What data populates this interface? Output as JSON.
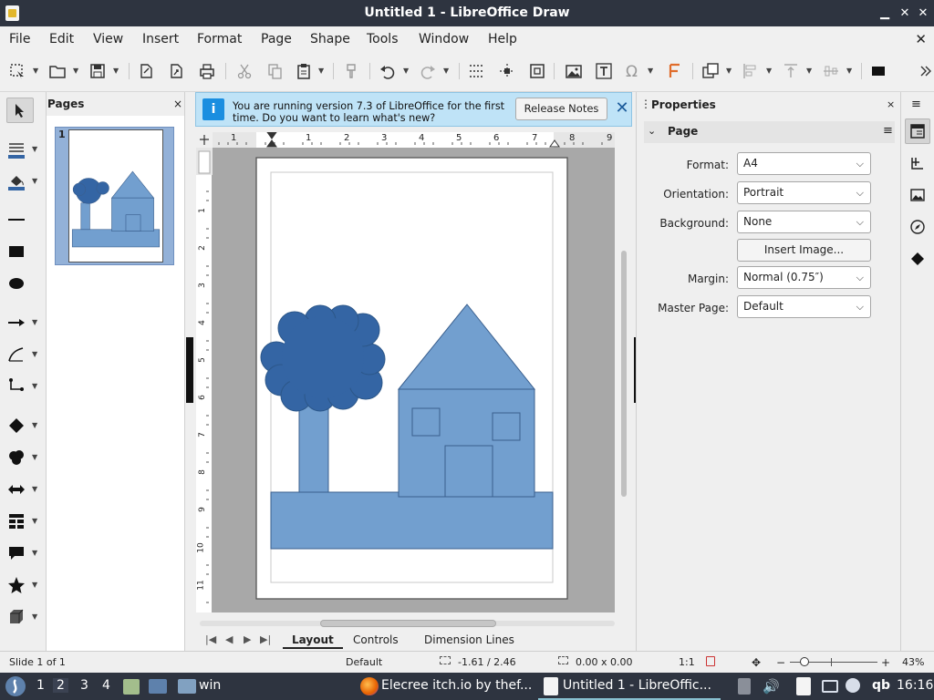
{
  "window": {
    "title": "Untitled 1 - LibreOffice Draw",
    "controls": [
      "minimize-icon",
      "restore-icon",
      "close-icon"
    ]
  },
  "menubar": {
    "items": [
      "File",
      "Edit",
      "View",
      "Insert",
      "Format",
      "Page",
      "Shape",
      "Tools",
      "Window",
      "Help"
    ],
    "close_glyph": "✕"
  },
  "toolbar": {
    "icons": [
      "select-mode-icon",
      "open-icon",
      "save-icon",
      "export-icon",
      "export-pdf-icon",
      "print-icon",
      "cut-icon",
      "copy-icon",
      "paste-icon",
      "clone-formatting-icon",
      "undo-icon",
      "redo-icon",
      "grid-icon",
      "helplines-icon",
      "zoom-pan-icon",
      "insert-image-icon",
      "insert-textbox-icon",
      "special-character-icon",
      "fontwork-icon",
      "transformations-icon",
      "align-icon",
      "arrange-icon",
      "distribute-icon",
      "shadow-icon",
      "more-icon"
    ]
  },
  "pages_panel": {
    "title": "Pages",
    "close": "×",
    "thumb_number": "1"
  },
  "infobar": {
    "message": "You are running version 7.3 of LibreOffice for the first time. Do you want to learn what's new?",
    "button": "Release Notes",
    "close": "✕"
  },
  "ruler": {
    "h_labels": [
      "1",
      "1",
      "2",
      "3",
      "4",
      "5",
      "6",
      "7",
      "8",
      "9"
    ],
    "v_labels": [
      "1",
      "2",
      "3",
      "4",
      "5",
      "6",
      "7",
      "8",
      "9",
      "10",
      "11"
    ]
  },
  "drawing": {
    "colors": {
      "light_blue": "#729fcf",
      "dark_blue": "#3465a4",
      "outline": "#3a5f8e"
    }
  },
  "tabs": {
    "items": [
      "Layout",
      "Controls",
      "Dimension Lines"
    ],
    "active": "Layout"
  },
  "properties": {
    "title": "Properties",
    "close": "×",
    "section": "Page",
    "fields": {
      "format_label": "Format:",
      "format_value": "A4",
      "orientation_label": "Orientation:",
      "orientation_value": "Portrait",
      "background_label": "Background:",
      "background_value": "None",
      "insert_image": "Insert Image...",
      "margin_label": "Margin:",
      "margin_value": "Normal (0.75″)",
      "master_label": "Master Page:",
      "master_value": "Default"
    }
  },
  "statusbar": {
    "slide": "Slide 1 of 1",
    "master": "Default",
    "position": "-1.61 / 2.46",
    "size": "0.00 x 0.00",
    "scale": "1:1",
    "zoom_minus": "−",
    "zoom_plus": "+",
    "zoom": "43%"
  },
  "taskbar": {
    "workspaces": [
      "1",
      "2",
      "3",
      "4"
    ],
    "active_workspace": "2",
    "folder_label": "win",
    "firefox_label": "Elecree itch.io by thef...",
    "libreoffice_label": "Untitled 1 - LibreOffic...",
    "tray_text": "qb",
    "clock": "16:16"
  }
}
